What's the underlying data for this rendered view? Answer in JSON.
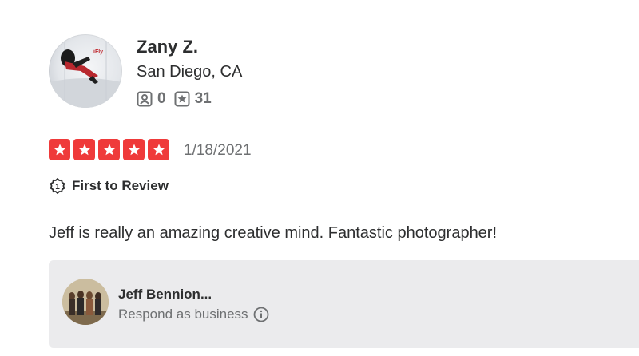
{
  "reviewer": {
    "name": "Zany Z.",
    "location": "San Diego, CA",
    "stats": {
      "friends": "0",
      "reviews": "31"
    }
  },
  "review": {
    "rating": 5,
    "rating_max": 5,
    "date": "1/18/2021",
    "badge": "First to Review",
    "text": "Jeff is really an amazing creative mind. Fantastic photographer!"
  },
  "owner_panel": {
    "name": "Jeff Bennion...",
    "action_label": "Respond as business"
  },
  "colors": {
    "star_red": "#ef3a3a",
    "panel_gray": "#ebebed",
    "text_dark": "#2d2e2f",
    "text_muted": "#6e7072"
  },
  "icons": {
    "friends": "friends-icon",
    "reviews": "review-star-icon",
    "badge": "first-to-review-badge-icon",
    "info": "info-icon"
  }
}
